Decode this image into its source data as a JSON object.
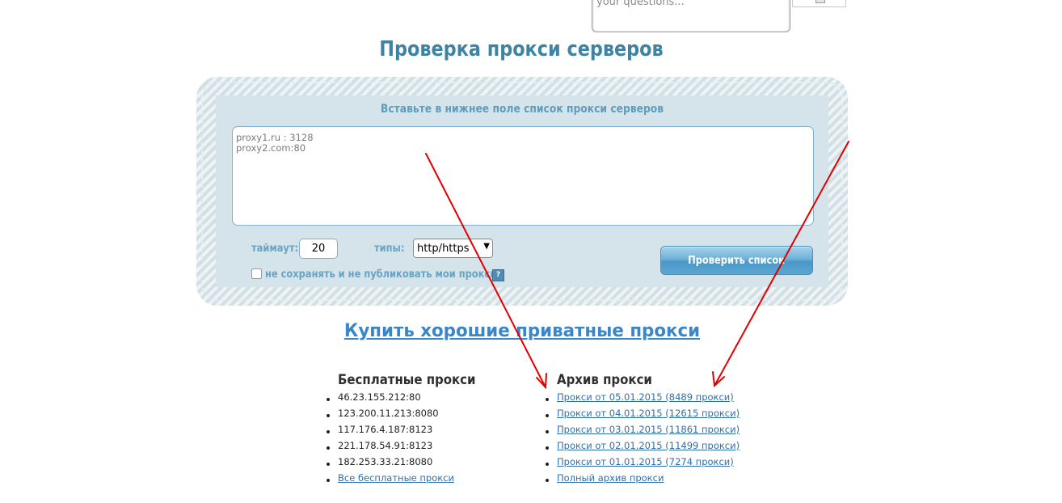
{
  "feedback": {
    "placeholder": "your questions..."
  },
  "page_title": "Проверка прокси серверов",
  "checker": {
    "hint": "Вставьте в нижнее поле список прокси серверов",
    "proxy_list_value": "proxy1.ru : 3128\nproxy2.com:80",
    "timeout_label": "таймаут:",
    "timeout_value": "20",
    "types_label": "типы:",
    "types_selected": "http/https",
    "nosave_label": "не сохранять и не публиковать мои прокси",
    "help_icon_text": "?",
    "check_button_label": "Проверить список"
  },
  "buy_link": "Купить хорошие приватные прокси",
  "free_proxies": {
    "title": "Бесплатные прокси",
    "items": [
      "46.23.155.212:80",
      "123.200.11.213:8080",
      "117.176.4.187:8123",
      "221.178.54.91:8123",
      "182.253.33.21:8080"
    ],
    "all_link": "Все бесплатные прокси"
  },
  "archive": {
    "title": "Архив прокси",
    "items": [
      "Прокси от 05.01.2015 (8489 прокси)",
      "Прокси от 04.01.2015 (12615 прокси)",
      "Прокси от 03.01.2015 (11861 прокси)",
      "Прокси от 02.01.2015 (11499 прокси)",
      "Прокси от 01.01.2015 (7274 прокси)"
    ],
    "full_link": "Полный архив прокси"
  },
  "colors": {
    "title_blue": "#3f83a4",
    "link_blue": "#2f6fae",
    "annotation_red": "#e00000"
  },
  "icons": [
    "broken-image-icon",
    "help-icon",
    "dropdown-arrow-icon",
    "annotation-arrow-icon"
  ]
}
